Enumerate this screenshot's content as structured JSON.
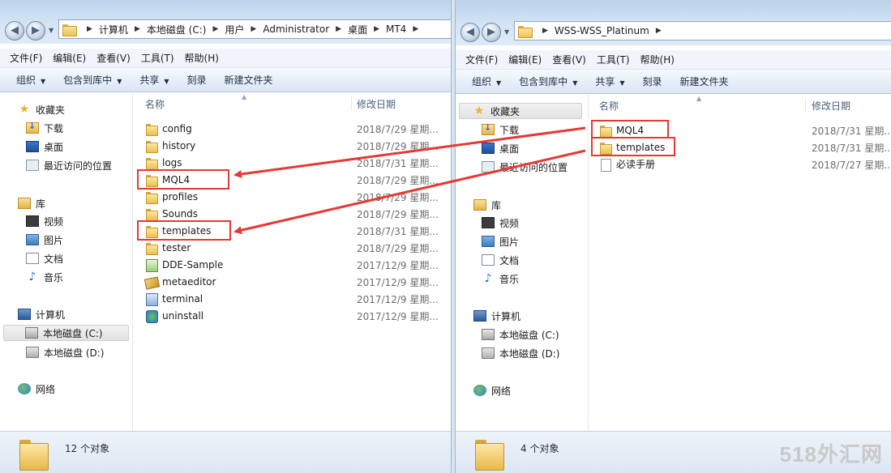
{
  "left": {
    "path": [
      "计算机",
      "本地磁盘 (C:)",
      "用户",
      "Administrator",
      "桌面",
      "MT4"
    ],
    "menu": [
      "文件(F)",
      "编辑(E)",
      "查看(V)",
      "工具(T)",
      "帮助(H)"
    ],
    "toolbar": {
      "organize": "组织",
      "include": "包含到库中",
      "share": "共享",
      "burn": "刻录",
      "new_folder": "新建文件夹"
    },
    "nav": {
      "favorites": "收藏夹",
      "downloads": "下载",
      "desktop": "桌面",
      "recent": "最近访问的位置",
      "libraries": "库",
      "videos": "视频",
      "pictures": "图片",
      "documents": "文档",
      "music": "音乐",
      "computer": "计算机",
      "drive_c": "本地磁盘 (C:)",
      "drive_d": "本地磁盘 (D:)",
      "network": "网络"
    },
    "columns": {
      "name": "名称",
      "date": "修改日期"
    },
    "files": [
      {
        "name": "config",
        "date": "2018/7/29 星期..."
      },
      {
        "name": "history",
        "date": "2018/7/29 星期..."
      },
      {
        "name": "logs",
        "date": "2018/7/31 星期..."
      },
      {
        "name": "MQL4",
        "date": "2018/7/29 星期..."
      },
      {
        "name": "profiles",
        "date": "2018/7/29 星期..."
      },
      {
        "name": "Sounds",
        "date": "2018/7/29 星期..."
      },
      {
        "name": "templates",
        "date": "2018/7/31 星期..."
      },
      {
        "name": "tester",
        "date": "2018/7/29 星期..."
      },
      {
        "name": "DDE-Sample",
        "date": "2017/12/9 星期..."
      },
      {
        "name": "metaeditor",
        "date": "2017/12/9 星期..."
      },
      {
        "name": "terminal",
        "date": "2017/12/9 星期..."
      },
      {
        "name": "uninstall",
        "date": "2017/12/9 星期..."
      }
    ],
    "status": "12 个对象"
  },
  "right": {
    "path": [
      "WSS-WSS_Platinum"
    ],
    "menu": [
      "文件(F)",
      "编辑(E)",
      "查看(V)",
      "工具(T)",
      "帮助(H)"
    ],
    "toolbar": {
      "organize": "组织",
      "include": "包含到库中",
      "share": "共享",
      "burn": "刻录",
      "new_folder": "新建文件夹"
    },
    "nav": {
      "favorites": "收藏夹",
      "downloads": "下载",
      "desktop": "桌面",
      "recent": "最近访问的位置",
      "libraries": "库",
      "videos": "视频",
      "pictures": "图片",
      "documents": "文档",
      "music": "音乐",
      "computer": "计算机",
      "drive_c": "本地磁盘 (C:)",
      "drive_d": "本地磁盘 (D:)",
      "network": "网络"
    },
    "columns": {
      "name": "名称",
      "date": "修改日期"
    },
    "files": [
      {
        "name": "MQL4",
        "date": "2018/7/31 星期..."
      },
      {
        "name": "templates",
        "date": "2018/7/31 星期..."
      },
      {
        "name": "必读手册",
        "date": "2018/7/27 星期..."
      }
    ],
    "status": "4 个对象"
  },
  "watermark": "518外汇网",
  "colors": {
    "highlight": "#e53935",
    "titlebar": "#b9d1ea"
  }
}
